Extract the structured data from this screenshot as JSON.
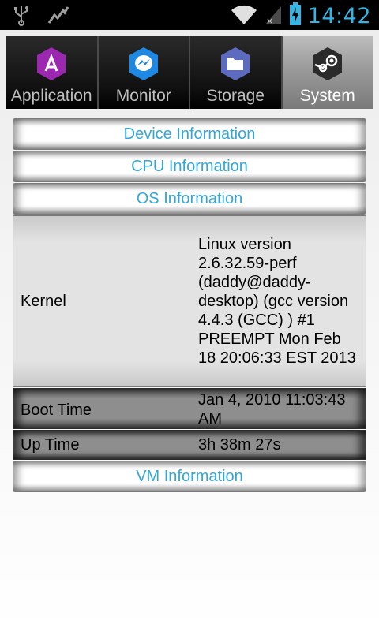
{
  "status_bar": {
    "time": "14:42",
    "icons": [
      "usb-icon",
      "activity-graph-icon",
      "wifi-icon",
      "signal-icon",
      "battery-charging-icon"
    ],
    "accent_color": "#33b5e5"
  },
  "tabs": [
    {
      "label": "Application",
      "icon": "app-store-icon",
      "icon_color": "#9c27b0",
      "active": false
    },
    {
      "label": "Monitor",
      "icon": "lightning-chat-icon",
      "icon_color": "#1e88e5",
      "active": false
    },
    {
      "label": "Storage",
      "icon": "folder-icon",
      "icon_color": "#5c6bc0",
      "active": false
    },
    {
      "label": "System",
      "icon": "steam-icon",
      "icon_color": "#2b2b2b",
      "active": true
    }
  ],
  "sections": {
    "device": "Device Information",
    "cpu": "CPU Information",
    "os": "OS Information",
    "vm": "VM Information"
  },
  "os_info": {
    "kernel": {
      "label": "Kernel",
      "value": "Linux version 2.6.32.59-perf (daddy@daddy-desktop) (gcc version 4.4.3 (GCC) ) #1 PREEMPT Mon Feb 18 20:06:33 EST 2013"
    },
    "boot_time": {
      "label": "Boot Time",
      "value": "Jan 4, 2010 11:03:43 AM"
    },
    "up_time": {
      "label": "Up Time",
      "value": "3h 38m 27s"
    }
  },
  "link_color": "#33a7d9"
}
